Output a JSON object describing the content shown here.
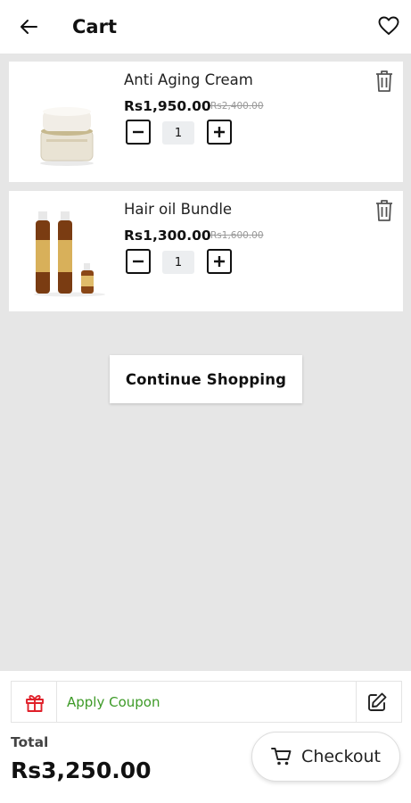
{
  "header": {
    "title": "Cart"
  },
  "cart": {
    "items": [
      {
        "name": "Anti Aging Cream",
        "price": "Rs1,950.00",
        "old_price": "Rs2,400.00",
        "quantity": "1"
      },
      {
        "name": "Hair oil Bundle",
        "price": "Rs1,300.00",
        "old_price": "Rs1,600.00",
        "quantity": "1"
      }
    ]
  },
  "actions": {
    "continue_label": "Continue Shopping"
  },
  "coupon": {
    "label": "Apply Coupon"
  },
  "summary": {
    "total_label": "Total",
    "total_value": "Rs3,250.00",
    "checkout_label": "Checkout"
  },
  "colors": {
    "coupon_text": "#3d9a27",
    "gift_icon": "#e0202a",
    "background": "#e6e6e6"
  },
  "icons": [
    "back-arrow-icon",
    "heart-icon",
    "trash-icon",
    "minus-icon",
    "plus-icon",
    "gift-icon",
    "edit-icon",
    "cart-icon"
  ]
}
